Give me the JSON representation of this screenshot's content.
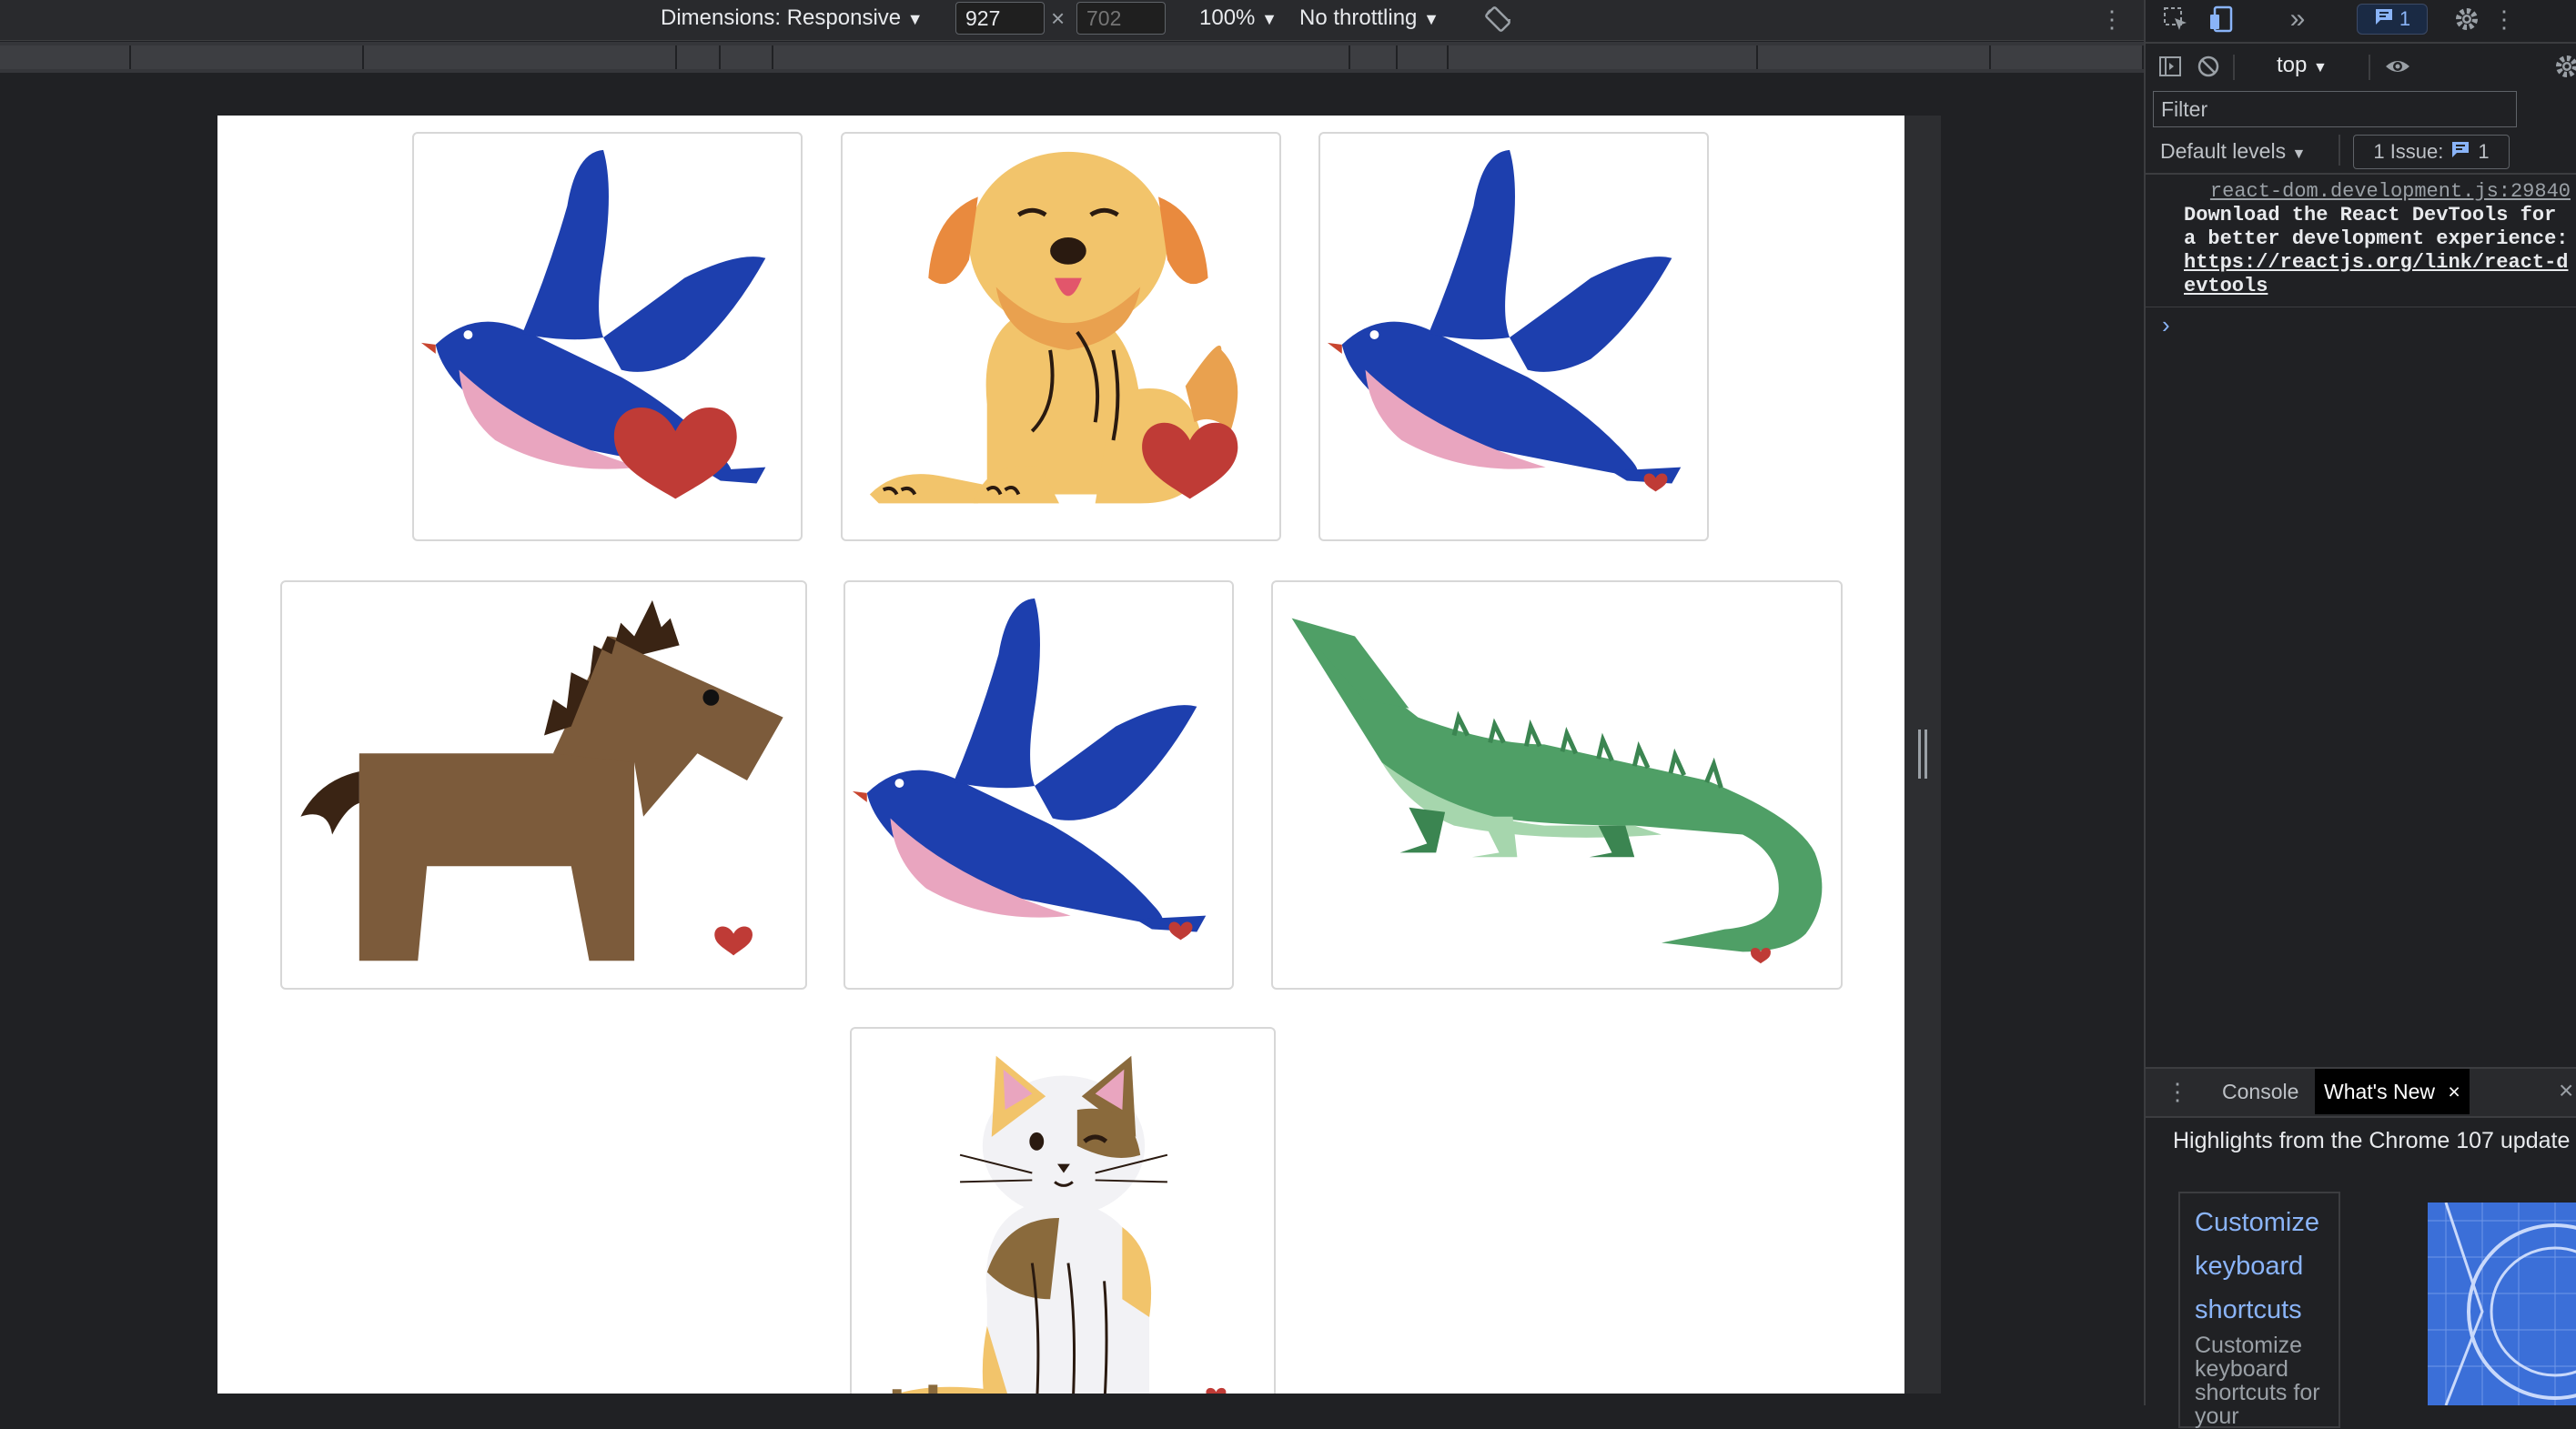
{
  "device_toolbar": {
    "dimensions_label": "Dimensions: Responsive",
    "width_value": "927",
    "height_placeholder": "702",
    "times_symbol": "×",
    "zoom": "100%",
    "throttling": "No throttling",
    "caret": "▼"
  },
  "page": {
    "cards": [
      {
        "animal": "bird",
        "heart": "large"
      },
      {
        "animal": "dog",
        "heart": "large"
      },
      {
        "animal": "bird",
        "heart": "small"
      },
      {
        "animal": "horse",
        "heart": "small"
      },
      {
        "animal": "bird",
        "heart": "small"
      },
      {
        "animal": "crocodile",
        "heart": "small"
      },
      {
        "animal": "cat",
        "heart": "small"
      }
    ]
  },
  "devtools": {
    "issue_count": "1",
    "context": "top",
    "filter_placeholder": "Filter",
    "levels": "Default levels",
    "issues_label": "1 Issue:",
    "issues_count": "1",
    "console": {
      "source": "react-dom.development.js:29840",
      "message": "Download the React DevTools for a better development experience: ",
      "link": "https://reactjs.org/link/react-devtools",
      "prompt": "›"
    },
    "drawer": {
      "tab_console": "Console",
      "tab_whats_new": "What's New",
      "close": "×"
    },
    "whats_new": {
      "title": "Highlights from the Chrome 107 update",
      "card_link_1": "Customize",
      "card_link_2": "keyboard",
      "card_link_3": "shortcuts",
      "card_desc": "Customize keyboard shortcuts for your"
    }
  },
  "colors": {
    "bird_blue": "#1d3fae",
    "bird_pink": "#e9a5bf",
    "heart_red": "#bf3b36",
    "dog_tan": "#f2c46b",
    "horse_brown": "#7c5b3b",
    "croc_green": "#4f9f66",
    "link_blue": "#8ab4f8"
  }
}
